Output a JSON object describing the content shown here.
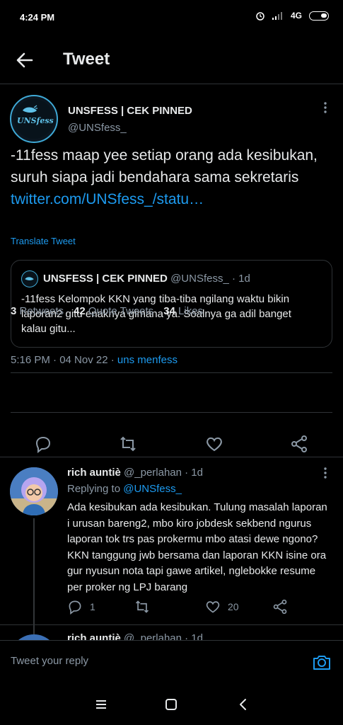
{
  "status_bar": {
    "time": "4:24 PM",
    "network": "4G"
  },
  "header": {
    "title": "Tweet"
  },
  "main_tweet": {
    "avatar_text": "UNSfess",
    "author_name": "UNSFESS | CEK PINNED",
    "author_handle": "@UNSfess_",
    "text": "-11fess maap yee setiap orang ada kesibukan, suruh siapa jadi bendahara sama sekretaris",
    "link": "twitter.com/UNSfess_/statu…",
    "translate_label": "Translate Tweet",
    "quoted": {
      "author_name": "UNSFESS | CEK PINNED",
      "author_handle": "@UNSfess_ · 1d",
      "text": "-11fess Kelompok KKN  yang tiba-tiba ngilang waktu bikin laporan2 gitu enaknya gimana ya. Soalnya ga adil banget kalau gitu..."
    },
    "timestamp": "5:16 PM · 04 Nov 22 · ",
    "source": "uns menfess",
    "stats": {
      "retweets_count": "3",
      "retweets_label": "Retweets",
      "quotes_count": "42",
      "quotes_label": "Quote Tweets",
      "likes_count": "34",
      "likes_label": "Likes"
    }
  },
  "reply": {
    "author_name": "rich auntiè",
    "author_handle": "@_perlahan · 1d",
    "replying_prefix": "Replying to ",
    "replying_to": "@UNSfess_",
    "text": "Ada kesibukan ada kesibukan. Tulung masalah laporan i urusan bareng2, mbo kiro jobdesk sekbend ngurus laporan tok trs pas prokermu mbo atasi dewe ngono? KKN tanggung jwb bersama dan laporan KKN isine ora gur nyusun nota tapi gawe artikel, nglebokke resume per proker ng LPJ barang",
    "reply_count": "1",
    "like_count": "20"
  },
  "next_reply": {
    "author_name": "rich auntiè",
    "author_handle": "@_perlahan · 1d"
  },
  "composer": {
    "placeholder": "Tweet your reply"
  },
  "colors": {
    "background": "#000000",
    "accent": "#1d9bf0",
    "secondary_text": "#8b98a5",
    "divider": "#2f3336"
  }
}
